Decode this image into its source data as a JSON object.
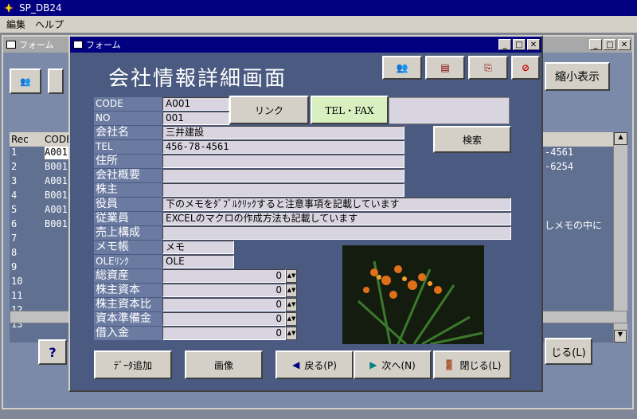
{
  "app": {
    "title": "SP_DB24"
  },
  "menu": [
    "編集",
    "ヘルプ"
  ],
  "back_window": {
    "title": "フォーム",
    "shrink_label": "縮小表示",
    "close_label": "じる(L)",
    "help_label": "?",
    "grid_headers": [
      "Rec",
      "CODE"
    ],
    "rows": [
      {
        "rec": "1",
        "code": "A001",
        "right": "-4561"
      },
      {
        "rec": "2",
        "code": "B001",
        "right": "-6254"
      },
      {
        "rec": "3",
        "code": "A001",
        "right": ""
      },
      {
        "rec": "4",
        "code": "B001",
        "right": ""
      },
      {
        "rec": "5",
        "code": "A001",
        "right": ""
      },
      {
        "rec": "6",
        "code": "B001",
        "right": "しメモの中に"
      },
      {
        "rec": "7",
        "code": "",
        "right": ""
      },
      {
        "rec": "8",
        "code": "",
        "right": ""
      },
      {
        "rec": "9",
        "code": "",
        "right": ""
      },
      {
        "rec": "10",
        "code": "",
        "right": ""
      },
      {
        "rec": "11",
        "code": "",
        "right": ""
      },
      {
        "rec": "12",
        "code": "",
        "right": ""
      },
      {
        "rec": "13",
        "code": "",
        "right": ""
      }
    ]
  },
  "form": {
    "window_title": "フォーム",
    "heading": "会社情報詳細画面",
    "link_label": "リンク",
    "telfax_label": "TEL・FAX",
    "search_label": "検索",
    "labels": {
      "code": "CODE",
      "no": "NO",
      "company": "会社名",
      "tel": "TEL",
      "address": "住所",
      "overview": "会社概要",
      "shareholder": "株主",
      "officer": "役員",
      "employee": "従業員",
      "sales": "売上構成",
      "memo": "メモ帳",
      "ole": "OLEﾘﾝｸ",
      "assets": "総資産",
      "capital": "株主資本",
      "capital_ratio": "株主資本比",
      "reserve": "資本準備金",
      "debt": "借入金"
    },
    "values": {
      "code": "A001",
      "no": "001",
      "company": "三井建設",
      "tel": "456-78-4561",
      "address": "",
      "overview": "",
      "shareholder": "",
      "officer": "下のメモをﾀﾞﾌﾞﾙｸﾘｯｸすると注意事項を記載しています",
      "employee": "EXCELのマクロの作成方法も記載しています",
      "sales": "",
      "memo": "メモ",
      "ole": "OLE",
      "assets": "0",
      "capital": "0",
      "capital_ratio": "0",
      "reserve": "0",
      "debt": "0"
    },
    "buttons": {
      "add": "ﾃﾞｰﾀ追加",
      "image": "画像",
      "back": "戻る(P)",
      "next": "次へ(N)",
      "close": "閉じる(L)"
    }
  }
}
